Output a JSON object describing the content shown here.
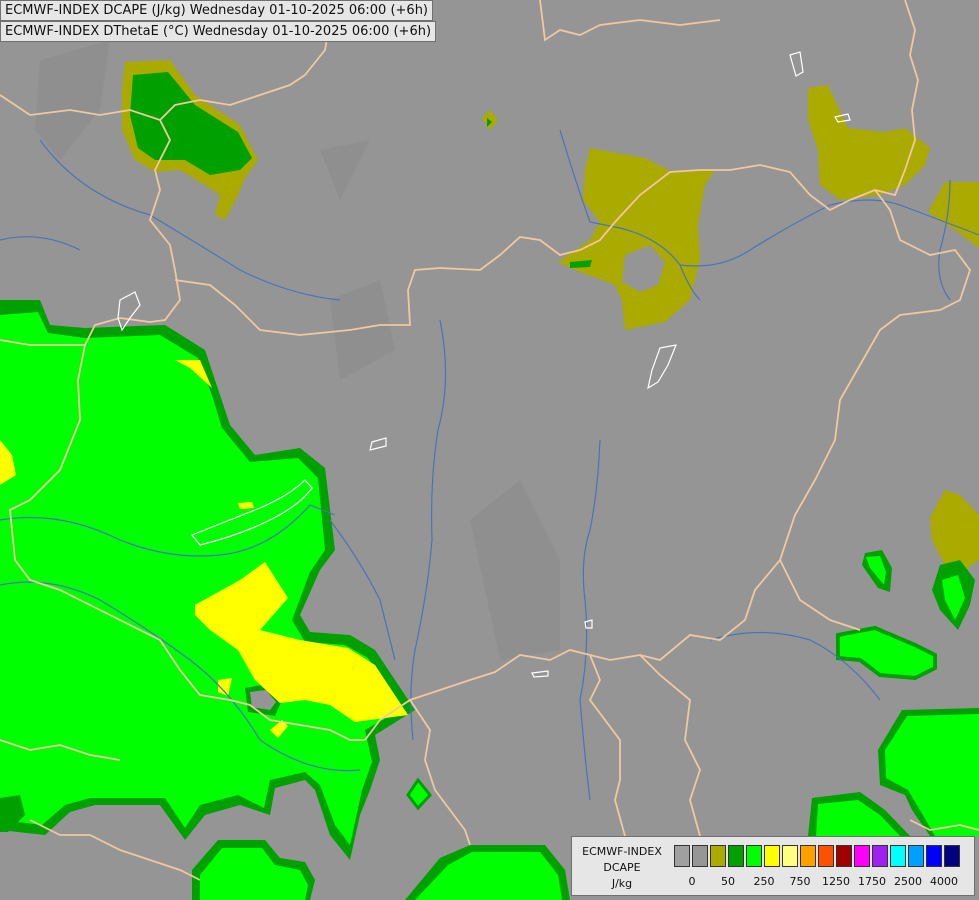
{
  "header": {
    "line1": "ECMWF-INDEX DCAPE (J/kg) Wednesday 01-10-2025 06:00 (+6h)",
    "line2": "ECMWF-INDEX DThetaE (°C) Wednesday 01-10-2025 06:00 (+6h)"
  },
  "legend": {
    "model": "ECMWF-INDEX",
    "variable": "DCAPE",
    "unit": "J/kg",
    "swatch_colors": [
      "#a0a0a0",
      "#969696",
      "#aaaa00",
      "#00a000",
      "#00ff00",
      "#ffff00",
      "#ffff80",
      "#ffa000",
      "#ff5000",
      "#a00000",
      "#ff00ff",
      "#a020f0",
      "#00ffff",
      "#00a0ff",
      "#0000ff",
      "#000080"
    ],
    "tick_labels": [
      "0",
      "50",
      "250",
      "750",
      "1250",
      "1750",
      "2500",
      "4000"
    ]
  },
  "colors": {
    "background": "#959595",
    "border": "#f0c8a0",
    "river": "#4a74b8",
    "lake": "#ffffff",
    "olive": "#aaaa00",
    "dark_green": "#00a000",
    "bright_green": "#00ff00",
    "yellow": "#ffff00"
  }
}
